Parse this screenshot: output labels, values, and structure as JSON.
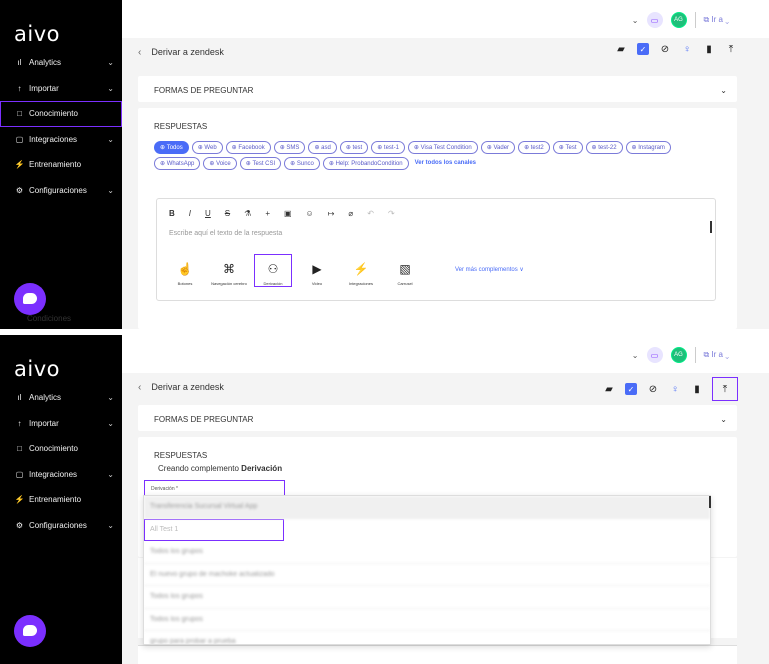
{
  "app": {
    "logo": "aivo"
  },
  "sidebar": {
    "items": [
      {
        "label": "Analytics",
        "icon": "bar-chart-icon",
        "glyph": "ıl",
        "chevron": true
      },
      {
        "label": "Importar",
        "icon": "upload-icon",
        "glyph": "↑",
        "chevron": true
      },
      {
        "label": "Conocimiento",
        "icon": "book-icon",
        "glyph": "□",
        "chevron": false
      },
      {
        "label": "Integraciones",
        "icon": "chat-square-icon",
        "glyph": "▢",
        "chevron": true
      },
      {
        "label": "Entrenamiento",
        "icon": "bolt-icon",
        "glyph": "⚡",
        "chevron": false
      },
      {
        "label": "Configuraciones",
        "icon": "gear-icon",
        "glyph": "⚙",
        "chevron": true
      }
    ],
    "accent": "#7b2fff"
  },
  "topbar": {
    "avatar": "AG",
    "ira": "Ir a"
  },
  "header": {
    "title": "Derivar a zendesk"
  },
  "sections": {
    "formas": "FORMAS DE PREGUNTAR",
    "respuestas": "RESPUESTAS",
    "conditions": "Condiciones"
  },
  "channels": [
    "Todos",
    "Web",
    "Facebook",
    "SMS",
    "asd",
    "test",
    "test-1",
    "Visa Test Condition",
    "Vader",
    "test2",
    "Test",
    "test-22",
    "Instagram",
    "WhatsApp",
    "Voice",
    "Test CSI",
    "Sunco",
    "Help: ProbandoCondition"
  ],
  "channels_see_all": "Ver todos los canales",
  "editor": {
    "tools": [
      "B",
      "I",
      "U",
      "S",
      "⚗",
      "+",
      "▣",
      "☺",
      "↦",
      "⌀",
      "↶",
      "↷"
    ],
    "placeholder": "Escribe aquí el texto de la respuesta",
    "components": [
      {
        "label": "Botones",
        "glyph": "☝",
        "icon": "hand-pointer-icon"
      },
      {
        "label": "Navegación cerebro",
        "glyph": "⌘",
        "icon": "command-icon"
      },
      {
        "label": "Derivación",
        "glyph": "⚇",
        "icon": "user-plus-icon"
      },
      {
        "label": "Video",
        "glyph": "▶",
        "icon": "video-icon"
      },
      {
        "label": "Integraciones",
        "glyph": "⚡",
        "icon": "bolt-icon"
      },
      {
        "label": "Carrusel",
        "glyph": "▧",
        "icon": "image-icon"
      }
    ],
    "more": "Ver más complementos ∨"
  },
  "panel_b": {
    "creating_prefix": "Creando complemento",
    "creating_name": "Derivación",
    "field_label": "Derivación *",
    "options": [
      "Transferencia Sucursal Virtual App",
      "All Test 1",
      "Todos los grupos",
      "El nuevo grupo de machoke actualizado",
      "Todos los grupos",
      "Todos los grupos",
      "grupo para probar a prueba"
    ]
  }
}
